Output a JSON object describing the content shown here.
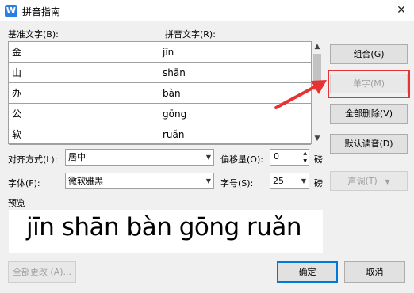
{
  "window": {
    "title": "拼音指南",
    "icon": "W"
  },
  "grid": {
    "base_header": "基准文字(B):",
    "pinyin_header": "拼音文字(R):",
    "rows": [
      {
        "base": "金",
        "pinyin": "jīn"
      },
      {
        "base": "山",
        "pinyin": "shān"
      },
      {
        "base": "办",
        "pinyin": "bàn"
      },
      {
        "base": "公",
        "pinyin": "gōng"
      },
      {
        "base": "软",
        "pinyin": "ruǎn"
      }
    ]
  },
  "buttons": {
    "combine": "组合(G)",
    "single_char": "单字(M)",
    "delete_all": "全部删除(V)",
    "default_reading": "默认读音(D)",
    "tone": "声调(T)",
    "change_all": "全部更改 (A)...",
    "ok": "确定",
    "cancel": "取消"
  },
  "options": {
    "align_label": "对齐方式(L):",
    "align_value": "居中",
    "offset_label": "偏移量(O):",
    "offset_value": "0",
    "offset_unit": "磅",
    "font_label": "字体(F):",
    "font_value": "微软雅黑",
    "size_label": "字号(S):",
    "size_value": "25",
    "size_unit": "磅"
  },
  "preview": {
    "label": "预览",
    "text": "jīn  shān bàn gōng ruǎn"
  },
  "colors": {
    "highlight": "#e53333",
    "arrow": "#e53333",
    "accent": "#0078d7"
  }
}
